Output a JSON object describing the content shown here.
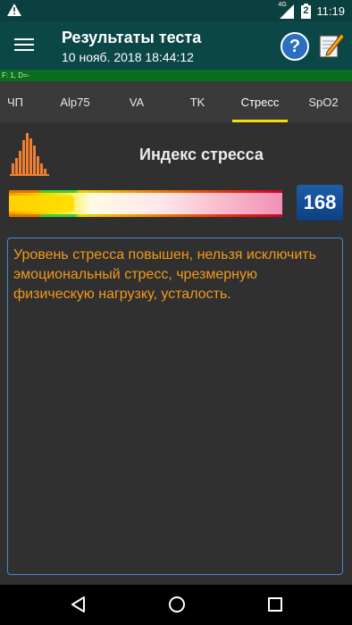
{
  "status_bar": {
    "time": "11:19",
    "network": "4G",
    "battery_level": "2"
  },
  "app_bar": {
    "title": "Результаты теста",
    "subtitle": "10 нояб. 2018  18:44:12"
  },
  "info_strip": {
    "text": "F: 1, D=-"
  },
  "tabs": [
    {
      "label": "ЧП"
    },
    {
      "label": "Alp75"
    },
    {
      "label": "VA"
    },
    {
      "label": "TK"
    },
    {
      "label": "Стресс"
    },
    {
      "label": "SpO2"
    }
  ],
  "active_tab": "Стресс",
  "stress": {
    "title": "Индекс стресса",
    "value": "168",
    "gauge_level_fraction": 0.24,
    "message": "Уровень стресса повышен, нельзя исключить эмоциональный стресс, чрезмерную физическую нагрузку, усталость."
  },
  "colors": {
    "app_bar": "#0c4747",
    "background": "#303030",
    "tab_indicator": "#f5e000",
    "message_text": "#f39a1a",
    "message_border": "#4a8ac8",
    "value_box": "#1c5fa8"
  },
  "icons": [
    "warning-icon",
    "signal-icon",
    "battery-icon",
    "menu-icon",
    "help-icon",
    "edit-icon",
    "stress-histogram-icon",
    "back-icon",
    "home-icon",
    "recent-apps-icon"
  ]
}
